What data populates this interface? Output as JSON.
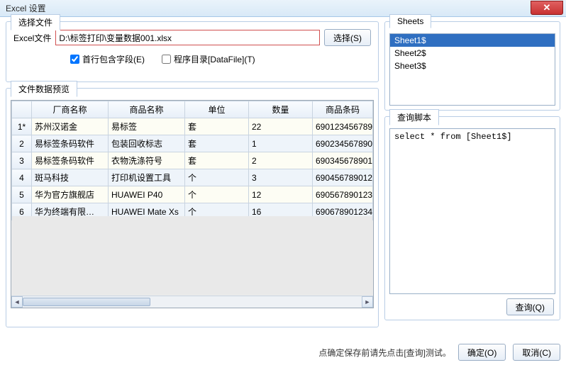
{
  "window": {
    "title": "Excel 设置"
  },
  "file_tab": {
    "tab_label": "选择文件",
    "field_label": "Excel文件",
    "file_path": "D:\\标签打印\\变量数据001.xlsx",
    "browse_button": "选择(S)",
    "chk_first_row": "首行包含字段(E)",
    "chk_datafile": "程序目录[DataFile](T)"
  },
  "preview": {
    "tab_label": "文件数据预览",
    "columns": [
      "",
      "厂商名称",
      "商品名称",
      "单位",
      "数量",
      "商品条码"
    ],
    "rows": [
      {
        "num": "1*",
        "cells": [
          "苏州汉诺金",
          "易标签",
          "套",
          "22",
          "690123456789"
        ]
      },
      {
        "num": "2",
        "cells": [
          "易标签条码软件",
          "包装回收标志",
          "套",
          "1",
          "690234567890"
        ]
      },
      {
        "num": "3",
        "cells": [
          "易标签条码软件",
          "衣物洗涤符号",
          "套",
          "2",
          "690345678901"
        ]
      },
      {
        "num": "4",
        "cells": [
          "斑马科技",
          "打印机设置工具",
          "个",
          "3",
          "690456789012"
        ]
      },
      {
        "num": "5",
        "cells": [
          "华为官方旗舰店",
          "HUAWEI P40",
          "个",
          "12",
          "690567890123"
        ]
      },
      {
        "num": "6",
        "cells": [
          "华为终端有限…",
          "HUAWEI Mate Xs",
          "个",
          "16",
          "690678901234"
        ]
      }
    ]
  },
  "sheets": {
    "tab_label": "Sheets",
    "items": [
      "Sheet1$",
      "Sheet2$",
      "Sheet3$"
    ],
    "selected_index": 0
  },
  "script": {
    "tab_label": "查询脚本",
    "text": "select * from [Sheet1$]",
    "query_button": "查询(Q)"
  },
  "footer": {
    "hint": "点确定保存前请先点击[查询]测试。",
    "ok": "确定(O)",
    "cancel": "取消(C)"
  }
}
